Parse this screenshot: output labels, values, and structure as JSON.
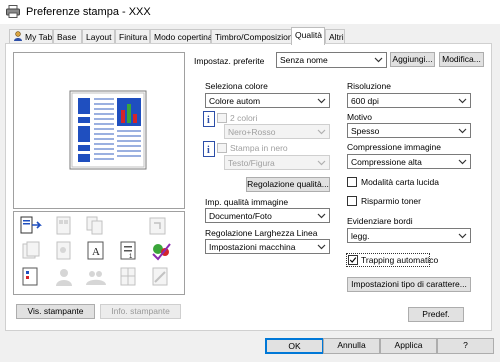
{
  "window": {
    "title": "Preferenze stampa - XXX"
  },
  "tabs": [
    {
      "label": "My Tab"
    },
    {
      "label": "Base"
    },
    {
      "label": "Layout"
    },
    {
      "label": "Finitura"
    },
    {
      "label": "Modo copertina"
    },
    {
      "label": "Timbro/Composizione"
    },
    {
      "label": "Qualità"
    },
    {
      "label": "Altri"
    }
  ],
  "active_tab": "Qualità",
  "favorites": {
    "label": "Impostaz. preferite",
    "value": "Senza nome",
    "add_label": "Aggiungi...",
    "edit_label": "Modifica..."
  },
  "left_buttons": {
    "printer_view": "Vis. stampante",
    "printer_info": "Info. stampante"
  },
  "color": {
    "label": "Seleziona colore",
    "value": "Colore autom",
    "two_colors_label": "2 colori",
    "two_colors_value": "Nero+Rosso",
    "print_black_label": "Stampa in nero",
    "print_black_value": "Testo/Figura",
    "quality_adjust_label": "Regolazione qualità..."
  },
  "image_quality": {
    "label": "Imp. qualità immagine",
    "value": "Documento/Foto"
  },
  "line_width": {
    "label": "Regolazione Larghezza Linea",
    "value": "Impostazioni macchina"
  },
  "resolution": {
    "label": "Risoluzione",
    "value": "600 dpi"
  },
  "pattern": {
    "label": "Motivo",
    "value": "Spesso"
  },
  "compression": {
    "label": "Compressione immagine",
    "value": "Compressione alta"
  },
  "glossy": {
    "label": "Modalità carta lucida",
    "checked": false
  },
  "toner_save": {
    "label": "Risparmio toner",
    "checked": false
  },
  "edge": {
    "label": "Evidenziare bordi",
    "value": "legg."
  },
  "trapping": {
    "label": "Trapping automatico",
    "checked": true
  },
  "font_settings": {
    "label": "Impostazioni tipo di carattere..."
  },
  "defaults": {
    "label": "Predef."
  },
  "footer": {
    "ok": "OK",
    "cancel": "Annulla",
    "apply": "Applica",
    "help": "?"
  },
  "colors": {
    "accent_blue": "#1f4fbf",
    "chart_red": "#d4242a",
    "chart_green": "#3aa53a"
  }
}
